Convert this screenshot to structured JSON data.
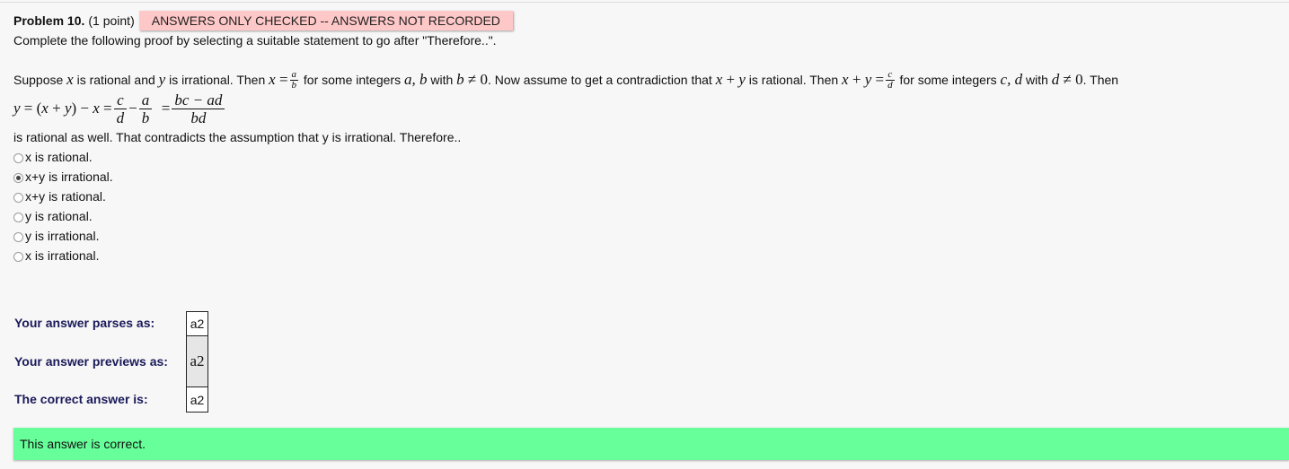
{
  "problem": {
    "title": "Problem 10.",
    "points": "(1 point)",
    "badge": "ANSWERS ONLY CHECKED -- ANSWERS NOT RECORDED",
    "instruction": "Complete the following proof by selecting a suitable statement to go after \"Therefore..\"."
  },
  "proof": {
    "p1": "Suppose",
    "p2": "is rational and",
    "p3": "is irrational. Then",
    "p4": "for some integers",
    "p5": "with",
    "p6": ". Now assume to get a contradiction that",
    "p7": "is rational. Then",
    "p8": "for some integers",
    "p9": "with",
    "p10": ". Then",
    "conclusion": "is rational as well. That contradicts the assumption that y is irrational. Therefore.."
  },
  "options": [
    {
      "label": "x is rational.",
      "selected": false
    },
    {
      "label": "x+y is irrational.",
      "selected": true
    },
    {
      "label": "x+y is rational.",
      "selected": false
    },
    {
      "label": "y is rational.",
      "selected": false
    },
    {
      "label": "y is irrational.",
      "selected": false
    },
    {
      "label": "x is irrational.",
      "selected": false
    }
  ],
  "results": {
    "parses_label": "Your answer parses as:",
    "parses_value": "a2",
    "preview_label": "Your answer previews as:",
    "preview_value": "a2",
    "correct_label": "The correct answer is:",
    "correct_value": "a2"
  },
  "status": {
    "message": "This answer is correct.",
    "color": "#66ff99"
  },
  "colors": {
    "badge_bg": "#ffc8c8",
    "label_color": "#1a1a5a"
  }
}
